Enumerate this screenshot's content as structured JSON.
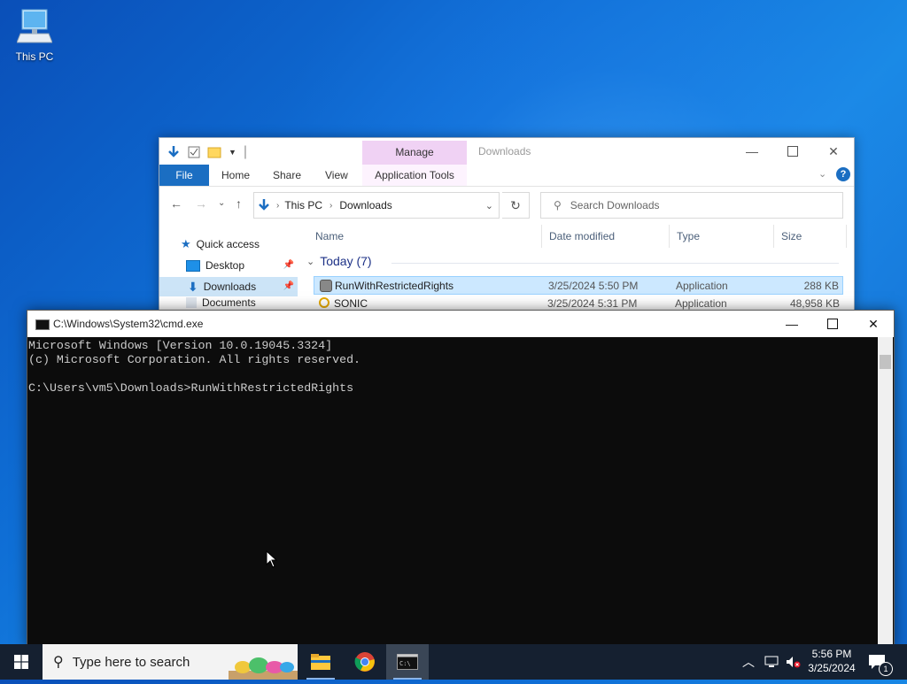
{
  "desktop": {
    "icons": [
      {
        "label": "This PC",
        "icon": "this-pc-icon"
      }
    ]
  },
  "explorer": {
    "title": "Downloads",
    "manage_tab": "Manage",
    "ribbon_tabs": [
      "File",
      "Home",
      "Share",
      "View",
      "Application Tools"
    ],
    "address": {
      "parts": [
        "This PC",
        "Downloads"
      ]
    },
    "search_placeholder": "Search Downloads",
    "nav": [
      {
        "label": "Quick access",
        "icon": "star-icon"
      },
      {
        "label": "Desktop",
        "icon": "desktop-folder-icon",
        "pinned": true
      },
      {
        "label": "Downloads",
        "icon": "download-arrow-icon",
        "pinned": true,
        "selected": true
      },
      {
        "label": "Documents",
        "icon": "documents-folder-icon"
      }
    ],
    "columns": [
      "Name",
      "Date modified",
      "Type",
      "Size"
    ],
    "group": "Today (7)",
    "files": [
      {
        "name": "RunWithRestrictedRights",
        "date": "3/25/2024 5:50 PM",
        "type": "Application",
        "size": "288 KB",
        "selected": true
      },
      {
        "name": "SONIC",
        "date": "3/25/2024 5:31 PM",
        "type": "Application",
        "size": "48,958 KB",
        "selected": false
      }
    ]
  },
  "cmd": {
    "title": "C:\\Windows\\System32\\cmd.exe",
    "lines": [
      "Microsoft Windows [Version 10.0.19045.3324]",
      "(c) Microsoft Corporation. All rights reserved.",
      "",
      "C:\\Users\\vm5\\Downloads>RunWithRestrictedRights"
    ]
  },
  "taskbar": {
    "search_placeholder": "Type here to search",
    "apps": [
      "file-explorer-icon",
      "chrome-icon",
      "cmd-icon"
    ],
    "clock": {
      "time": "5:56 PM",
      "date": "3/25/2024"
    },
    "notification_count": "1"
  },
  "colors": {
    "accent": "#1b6ec2",
    "taskbar": "#152030",
    "console_bg": "#0c0c0c",
    "console_text": "#cccccc"
  }
}
